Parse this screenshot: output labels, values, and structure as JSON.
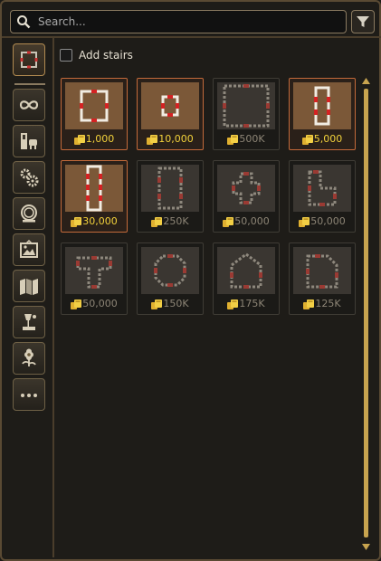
{
  "search": {
    "placeholder": "Search..."
  },
  "filter": {
    "icon": "filter-icon"
  },
  "categories": [
    {
      "name": "category-floor-plans",
      "icon": "floor-plan-icon",
      "active": true
    },
    {
      "name": "category-infinite",
      "icon": "infinity-icon",
      "active": false
    },
    {
      "name": "category-furniture",
      "icon": "furniture-icon",
      "active": false
    },
    {
      "name": "category-mechanics",
      "icon": "gears-icon",
      "active": false
    },
    {
      "name": "category-decor",
      "icon": "mirror-icon",
      "active": false
    },
    {
      "name": "category-paintings",
      "icon": "painting-icon",
      "active": false
    },
    {
      "name": "category-walls",
      "icon": "wall-panel-icon",
      "active": false
    },
    {
      "name": "category-lighting",
      "icon": "lamp-icon",
      "active": false
    },
    {
      "name": "category-plants",
      "icon": "flower-icon",
      "active": false
    },
    {
      "name": "category-more",
      "icon": "more-icon",
      "active": false
    }
  ],
  "add_stairs": {
    "label": "Add stairs",
    "checked": false
  },
  "tiles": [
    {
      "shape": "square",
      "price": "1,000",
      "owned": true
    },
    {
      "shape": "small-square",
      "price": "10,000",
      "owned": true
    },
    {
      "shape": "large-square",
      "price": "500K",
      "owned": false
    },
    {
      "shape": "narrow-rect",
      "price": "5,000",
      "owned": true
    },
    {
      "shape": "long-narrow",
      "price": "30,000",
      "owned": true
    },
    {
      "shape": "tall-rect",
      "price": "250K",
      "owned": false
    },
    {
      "shape": "cross",
      "price": "50,000",
      "owned": false
    },
    {
      "shape": "l-shape",
      "price": "50,000",
      "owned": false
    },
    {
      "shape": "t-shape",
      "price": "50,000",
      "owned": false
    },
    {
      "shape": "octagon",
      "price": "150K",
      "owned": false
    },
    {
      "shape": "house",
      "price": "175K",
      "owned": false
    },
    {
      "shape": "cut-corner",
      "price": "125K",
      "owned": false
    }
  ],
  "colors": {
    "accent": "#c8a44f",
    "owned_border": "#c46a3a",
    "price_owned": "#f3d23b",
    "price_locked": "#8d8576"
  }
}
